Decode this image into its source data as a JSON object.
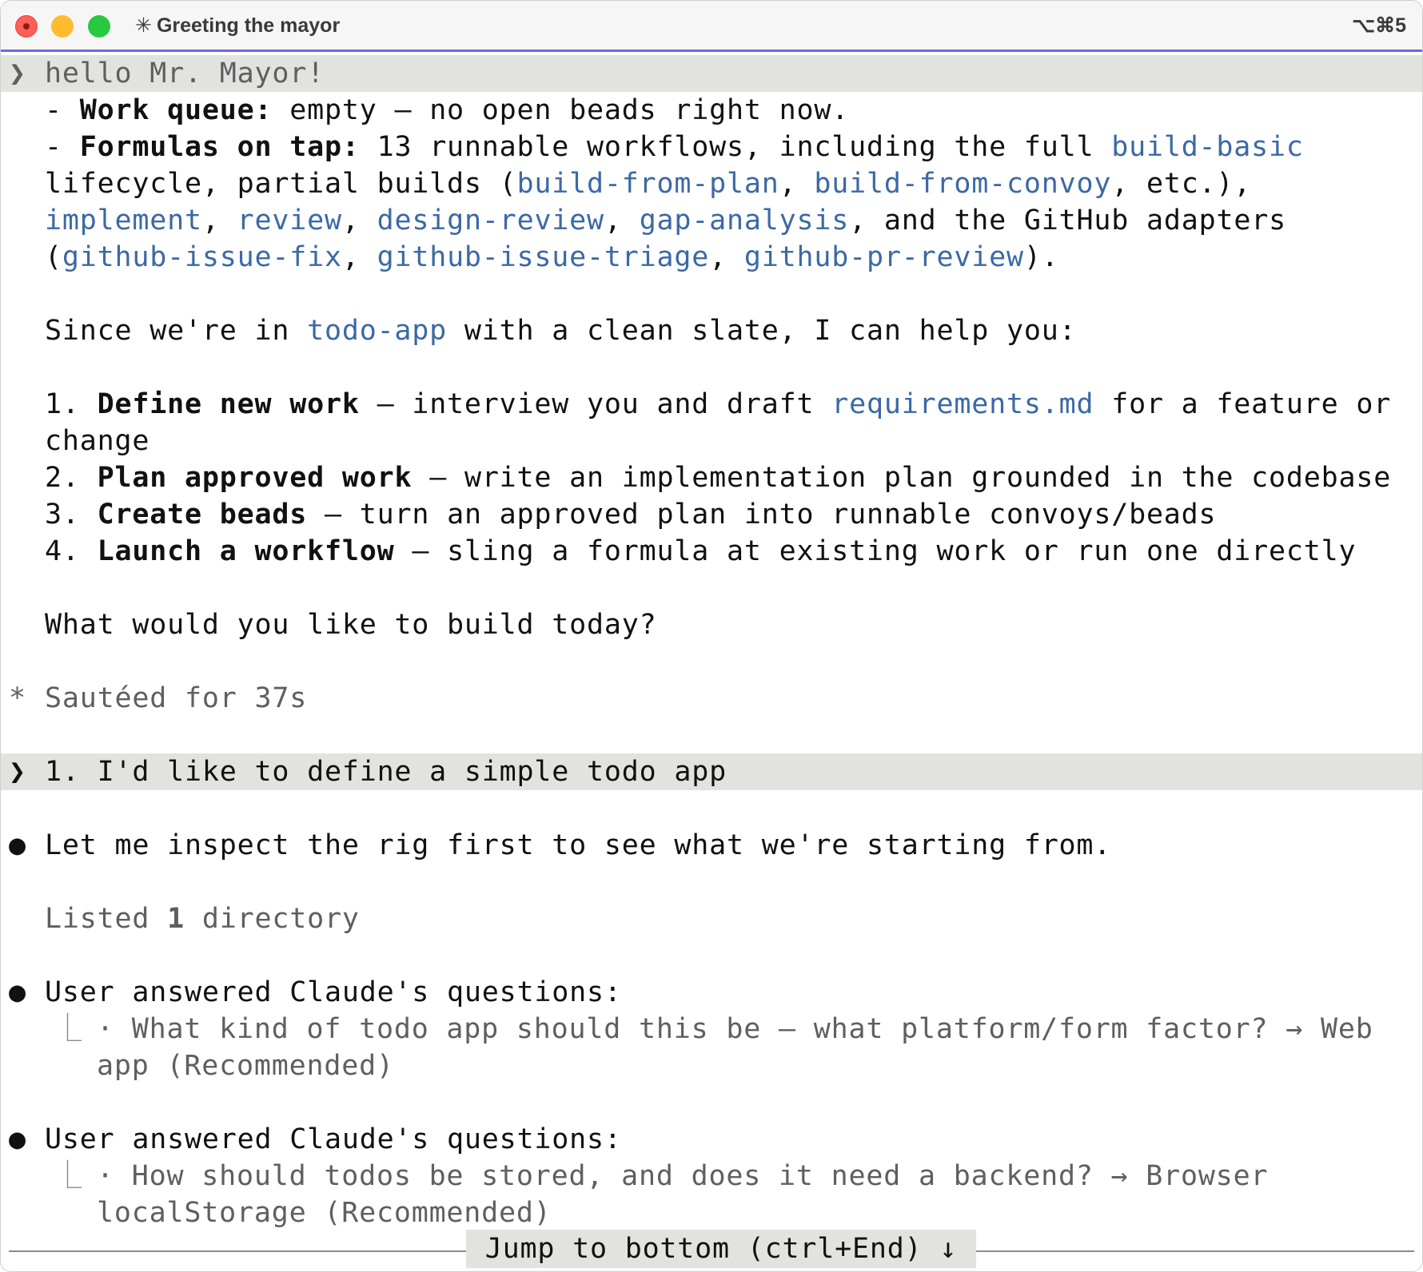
{
  "window": {
    "title": "Greeting the mayor",
    "shortcut": "⌥⌘5"
  },
  "prompt1": {
    "symbol": "❯",
    "text": "hello Mr. Mayor!"
  },
  "reply": {
    "wq_label": "Work queue:",
    "wq_text": " empty — no open beads right now.",
    "ft_label": "Formulas on tap:",
    "ft_text": " 13 runnable workflows, including the full ",
    "ft_links": [
      "build-basic",
      "build-from-plan",
      "build-from-convoy",
      "implement",
      "review",
      "design-review",
      "gap-analysis",
      "github-issue-fix",
      "github-issue-triage",
      "github-pr-review"
    ],
    "ft_lifecycle": "lifecycle, partial builds (",
    "ft_etc": ", etc.),",
    "ft_github": ", and the GitHub adapters",
    "since_pre": "Since we're in ",
    "since_link": "todo-app",
    "since_post": " with a clean slate, I can help you:",
    "items": [
      {
        "num": "1. ",
        "label": "Define new work",
        "pre": " — interview you and draft ",
        "link": "requirements.md",
        "post": " for a feature or",
        "cont": "change"
      },
      {
        "num": "2. ",
        "label": "Plan approved work",
        "text": " — write an implementation plan grounded in the codebase"
      },
      {
        "num": "3. ",
        "label": "Create beads",
        "text": " — turn an approved plan into runnable convoys/beads"
      },
      {
        "num": "4. ",
        "label": "Launch a workflow",
        "text": " — sling a formula at existing work or run one directly"
      }
    ],
    "question": "What would you like to build today?"
  },
  "status": {
    "symbol": "*",
    "text": "Sautéed for 37s"
  },
  "prompt2": {
    "symbol": "❯",
    "text": "1. I'd like to define a simple todo app"
  },
  "inspect": {
    "symbol": "●",
    "text": "Let me inspect the rig first to see what we're starting from."
  },
  "listed": {
    "pre": "Listed ",
    "count": "1",
    "post": " directory"
  },
  "answers": [
    {
      "symbol": "●",
      "header": "User answered Claude's questions:",
      "tree": "⎿",
      "line1": "· What kind of todo app should this be — what platform/form factor? → Web",
      "line2": "app (Recommended)"
    },
    {
      "symbol": "●",
      "header": "User answered Claude's questions:",
      "tree": "⎿",
      "line1": "· How should todos be stored, and does it need a backend? → Browser",
      "line2": "localStorage (Recommended)"
    }
  ],
  "footer": {
    "jump": "Jump to bottom (ctrl+End) ↓"
  }
}
